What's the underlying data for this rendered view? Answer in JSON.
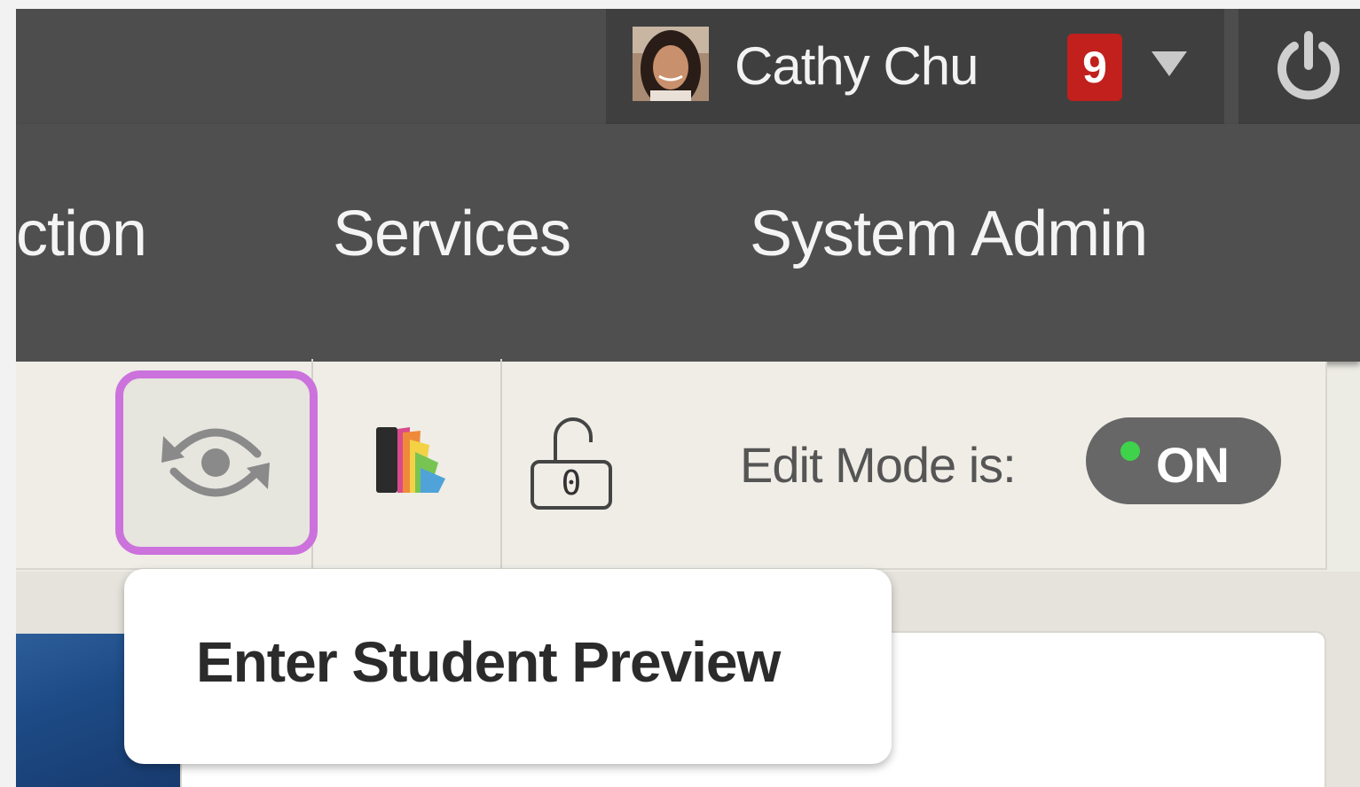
{
  "user": {
    "name": "Cathy Chu",
    "notification_count": "9",
    "avatar": "user-avatar-photo"
  },
  "nav": {
    "items": [
      {
        "label": "ction"
      },
      {
        "label": "Services"
      },
      {
        "label": "System Admin"
      }
    ]
  },
  "toolbar": {
    "student_preview_icon": "eye-refresh-icon",
    "theme_icon": "color-palette-icon",
    "lock_icon": "unlock-icon",
    "lock_count": "0",
    "edit_mode_label": "Edit Mode is:",
    "edit_mode_state": "ON"
  },
  "tooltip": {
    "text": "Enter Student Preview"
  },
  "colors": {
    "highlight": "#cc72dc",
    "badge": "#c1201d",
    "toggle_on": "#3fd24b",
    "header": "#4d4d4d"
  }
}
